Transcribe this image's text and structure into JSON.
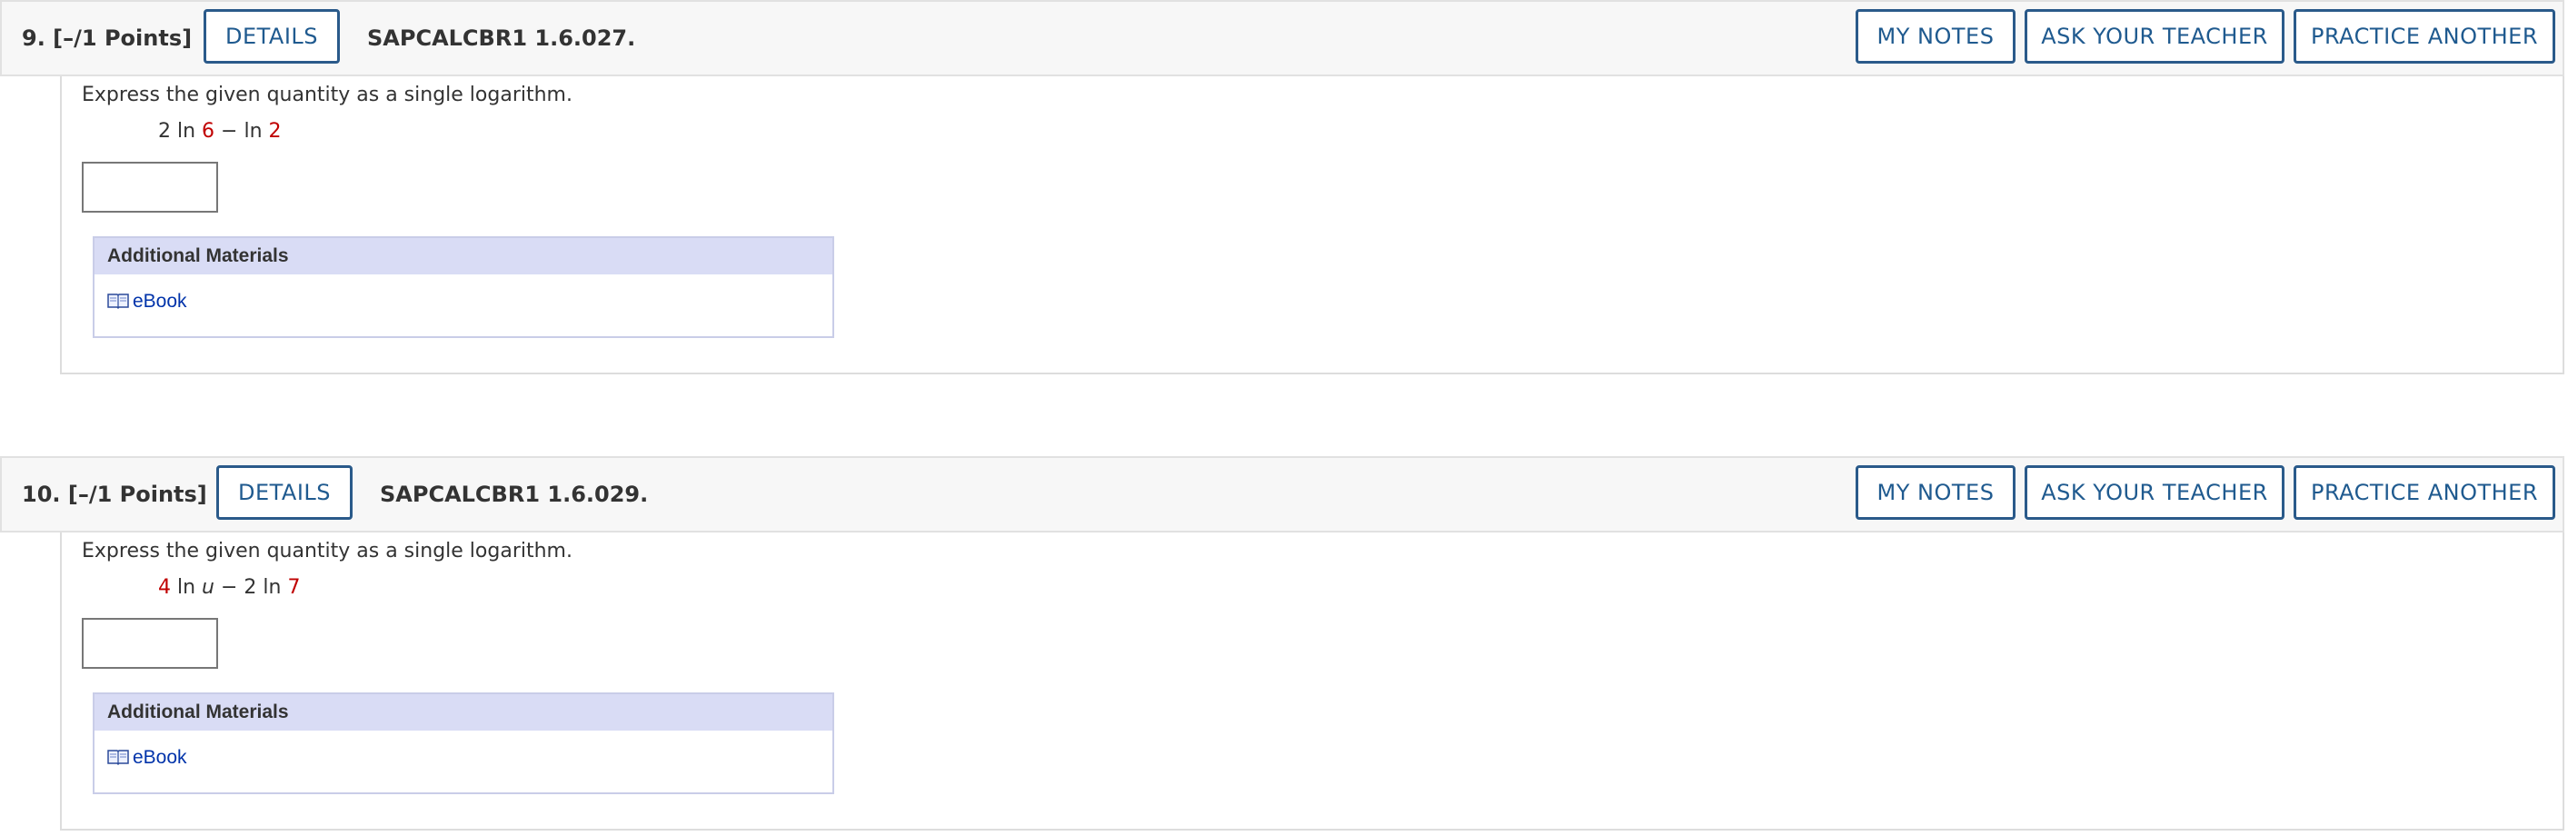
{
  "questions": [
    {
      "label": "9.  [–/1 Points]",
      "details_label": "DETAILS",
      "code": "SAPCALCBR1 1.6.027.",
      "my_notes_label": "MY NOTES",
      "ask_teacher_label": "ASK YOUR TEACHER",
      "practice_label": "PRACTICE ANOTHER",
      "prompt": "Express the given quantity as a single logarithm.",
      "expr": {
        "t1": "2 ln ",
        "t2": "6",
        "t3": " − ln ",
        "t4": "2"
      },
      "answer_value": "",
      "materials_title": "Additional Materials",
      "ebook_label": "eBook"
    },
    {
      "label": "10.  [–/1 Points]",
      "details_label": "DETAILS",
      "code": "SAPCALCBR1 1.6.029.",
      "my_notes_label": "MY NOTES",
      "ask_teacher_label": "ASK YOUR TEACHER",
      "practice_label": "PRACTICE ANOTHER",
      "prompt": "Express the given quantity as a single logarithm.",
      "expr": {
        "t1": "4",
        "t2": " ln ",
        "t3": "u",
        "t4": " − 2 ln ",
        "t5": "7"
      },
      "answer_value": "",
      "materials_title": "Additional Materials",
      "ebook_label": "eBook"
    }
  ],
  "colors": {
    "accent": "#1f5a8f",
    "highlight_red": "#c00000",
    "materials_header": "#d9dcf5",
    "link": "#0033aa"
  },
  "icons": {
    "ebook": "open-book-icon"
  }
}
